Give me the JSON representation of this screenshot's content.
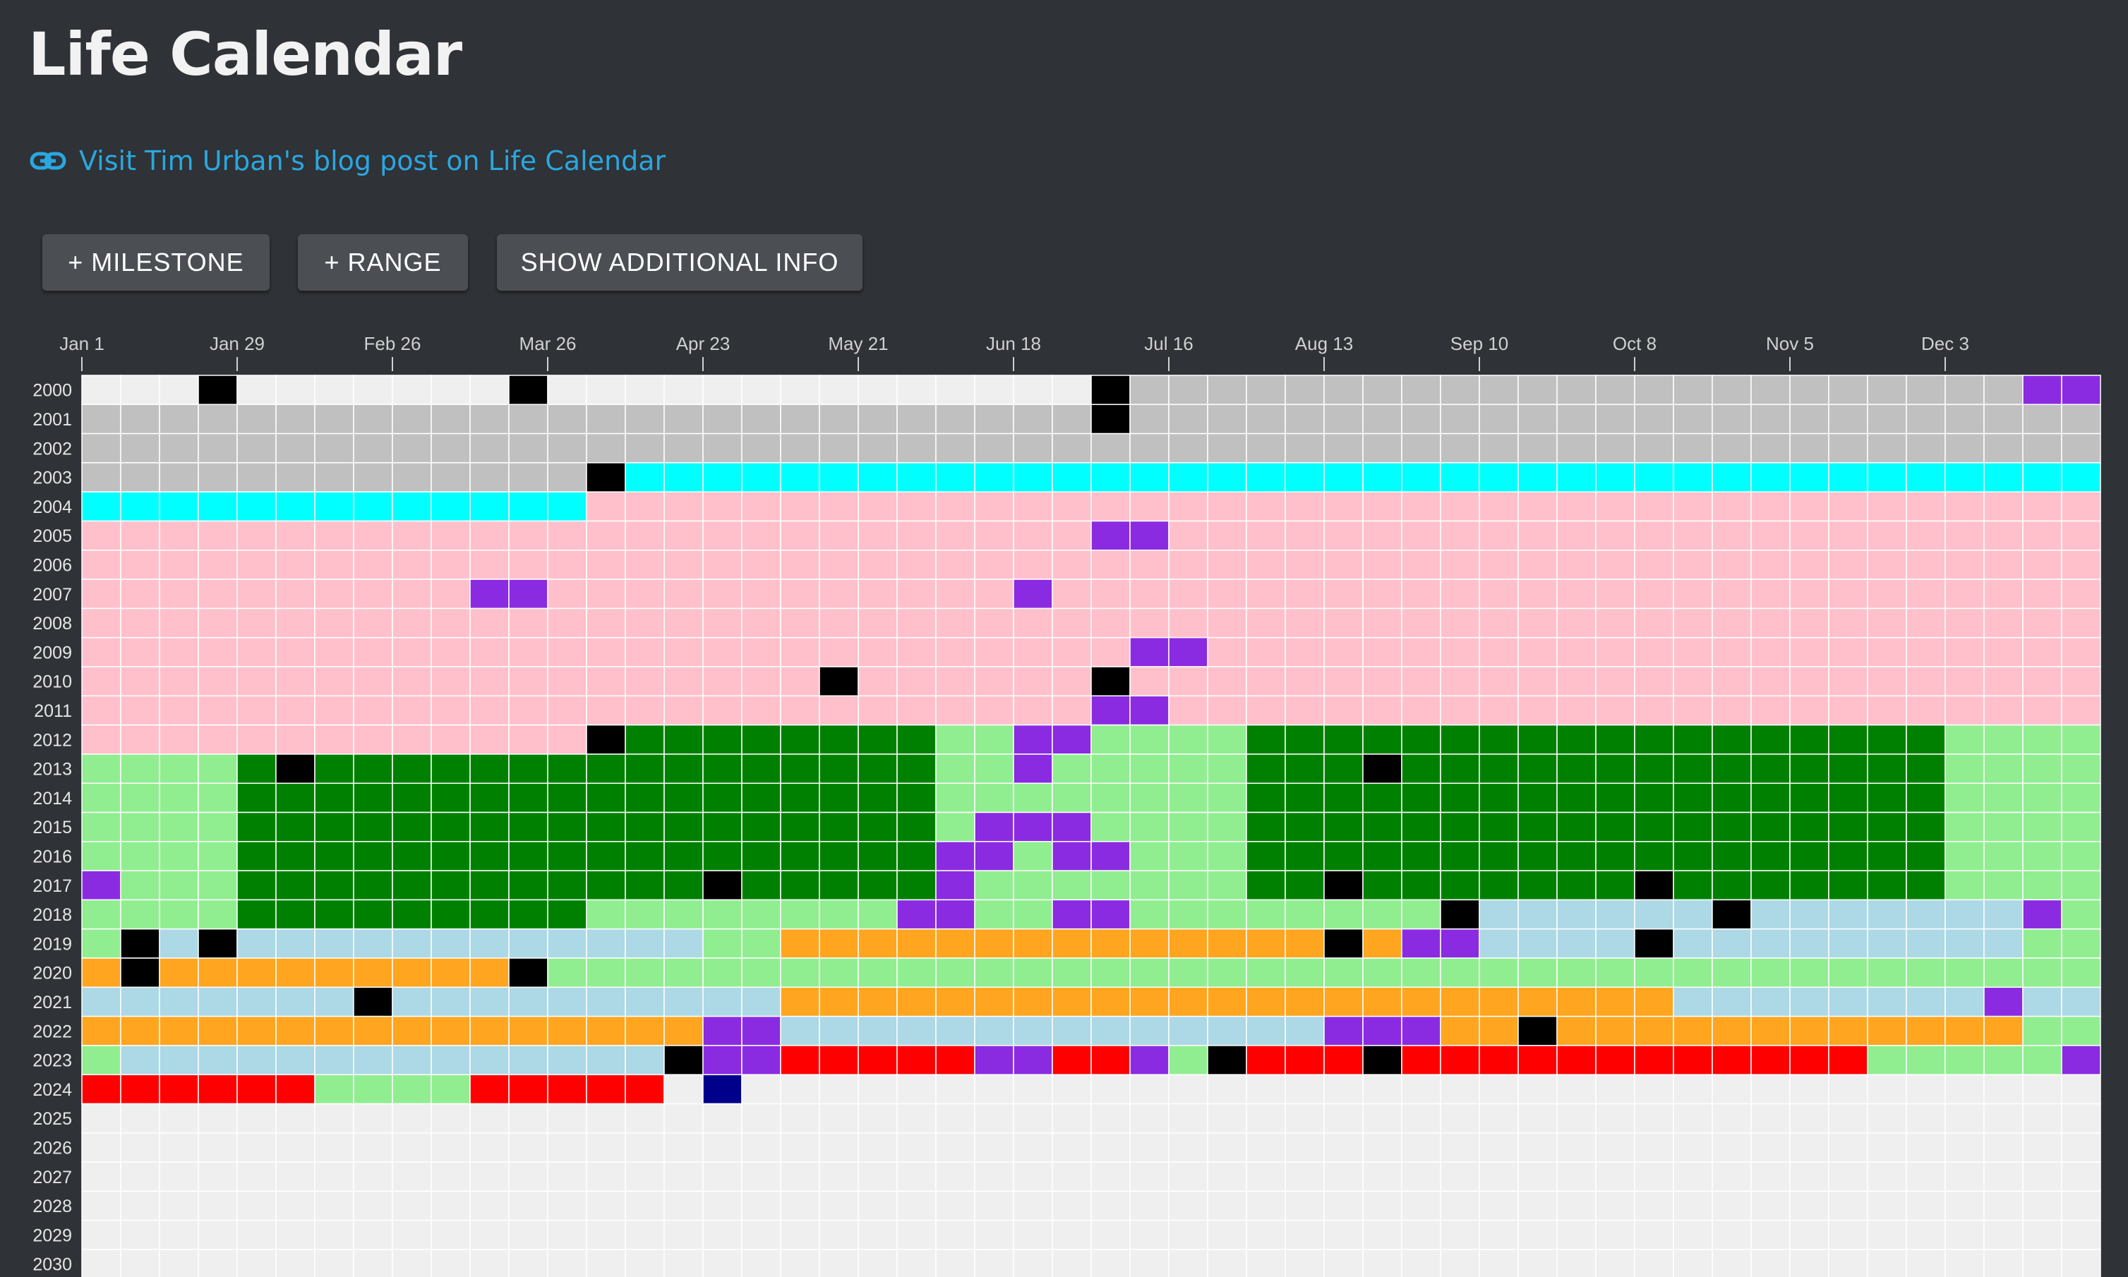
{
  "app": {
    "title": "Life Calendar",
    "link_text": "Visit Tim Urban's blog post on Life Calendar",
    "link_icon": "link-icon"
  },
  "toolbar": {
    "milestone_label": "+ MILESTONE",
    "range_label": "+ RANGE",
    "info_label": "SHOW ADDITIONAL INFO"
  },
  "calendar": {
    "week_labels": [
      "Jan 1",
      "Jan 29",
      "Feb 26",
      "Mar 26",
      "Apr 23",
      "May 21",
      "Jun 18",
      "Jul 16",
      "Aug 13",
      "Sep 10",
      "Oct 8",
      "Nov 5",
      "Dec 3"
    ],
    "years": [
      "2000",
      "2001",
      "2002",
      "2003",
      "2004",
      "2005",
      "2006",
      "2007",
      "2008",
      "2009",
      "2010",
      "2011",
      "2012",
      "2013",
      "2014",
      "2015",
      "2016",
      "2017",
      "2018",
      "2019",
      "2020",
      "2021",
      "2022",
      "2023",
      "2024",
      "2025",
      "2026",
      "2027",
      "2028",
      "2029",
      "2030"
    ],
    "weeks_per_year": 52,
    "colors": {
      "E": "#efefef",
      "G": "#c0c0c0",
      "C": "#00ffff",
      "P": "#ffc0cb",
      "L": "#90ee90",
      "D": "#008000",
      "B": "#add8e6",
      "O": "#ffa51f",
      "R": "#ff0000",
      "U": "#8a2be2",
      "K": "#000000",
      "N": "#00008b"
    },
    "rows": [
      "EEEKEEEEEEEKEEEEEEEEEEEEEEKGGGGGGGGGGGGGGGGGGGGGGGUU",
      "GGGGGGGGGGGGGGGGGGGGGGGGGGKGGGGGGGGGGGGGGGGGGGGGGGGG",
      "GGGGGGGGGGGGGGGGGGGGGGGGGGGGGGGGGGGGGGGGGGGGGGGGGGGG",
      "GGGGGGGGGGGGGKCCCCCCCCCCCCCCCCCCCCCCCCCCCCCCCCCCCCCC",
      "CCCCCCCCCCCCCPPPPPPPPPPPPPPPPPPPPPPPPPPPPPPPPPPPPPPP",
      "PPPPPPPPPPPPPPPPPPPPPPPPPPUUPPPPPPPPPPPPPPPPPPPPPPPP",
      "PPPPPPPPPPPPPPPPPPPPPPPPPPPPPPPPPPPPPPPPPPPPPPPPPPPP",
      "PPPPPPPPPPUUPPPPPPPPPPPPUPPPPPPPPPPPPPPPPPPPPPPPPPPP",
      "PPPPPPPPPPPPPPPPPPPPPPPPPPPPPPPPPPPPPPPPPPPPPPPPPPPP",
      "PPPPPPPPPPPPPPPPPPPPPPPPPPPUUPPPPPPPPPPPPPPPPPPPPPPP",
      "PPPPPPPPPPPPPPPPPPPKPPPPPPKPPPPPPPPPPPPPPPPPPPPPPPPP",
      "PPPPPPPPPPPPPPPPPPPPPPPPPPUUPPPPPPPPPPPPPPPPPPPPPPPP",
      "PPPPPPPPPPPPPKDDDDDDDDLLUULLLLDDDDDDDDDDDDDDDDDDLLLL",
      "LLLLDKDDDDDDDDDDDDDDDDLLULLLLLDDDKDDDDDDDDDDDDDDLLLL",
      "LLLLDDDDDDDDDDDDDDDDDDLLLLLLLLDDDDDDDDDDDDDDDDDDLLLL",
      "LLLLDDDDDDDDDDDDDDDDDDLUUULLLLDDDDDDDDDDDDDDDDDDLLLL",
      "LLLLDDDDDDDDDDDDDDDDDDUULUULLLDDDDDDDDDDDDDDDDDDLLLL",
      "ULLLDDDDDDDDDDDDKDDDDDULLLLLLLDDKDDDDDDDKDDDDDDDLLLL",
      "LLLLDDDDDDDDDLLLLLLLLUULLUULLLLLLLLKBBBBBBKBBBBBBBUL",
      "LKBKBBBBBBBBBBBBLLOOOOOOOOOOOOOOKOUUBBBBKBBBBBBBBBLL",
      "OKOOOOOOOOOKLLLLLLLLLLLLLLLLLLLLLLLLLLLLLLLLLLLLLLLL",
      "BBBBBBBKBBBBBBBBBBOOOOOOOOOOOOOOOOOOOOOOOBBBBBBBBUBBBBLL",
      "OOOOOOOOOOOOOOOOUUBBBBBBBBBBBBBBUUUOOKOOOOOOOOOOOOLL",
      "LBBBBBBBBBBBBBBKUURRRRRUURRULKRRRKRRRRRRRRRRRRLLLLLU",
      "RRRRRRLLLLRRRRRENEEEEEEEEEEEEEEEEEEEEEEEEEEEEEEEEEEE",
      "EEEEEEEEEEEEEEEEEEEEEEEEEEEEEEEEEEEEEEEEEEEEEEEEEEEE",
      "EEEEEEEEEEEEEEEEEEEEEEEEEEEEEEEEEEEEEEEEEEEEEEEEEEEE",
      "EEEEEEEEEEEEEEEEEEEEEEEEEEEEEEEEEEEEEEEEEEEEEEEEEEEE",
      "EEEEEEEEEEEEEEEEEEEEEEEEEEEEEEEEEEEEEEEEEEEEEEEEEEEE",
      "EEEEEEEEEEEEEEEEEEEEEEEEEEEEEEEEEEEEEEEEEEEEEEEEEEEE",
      "EEEEEEEEEEEEEEEEEEEEEEEEEEEEEEEEEEEEEEEEEEEEEEEEEEEE"
    ]
  }
}
